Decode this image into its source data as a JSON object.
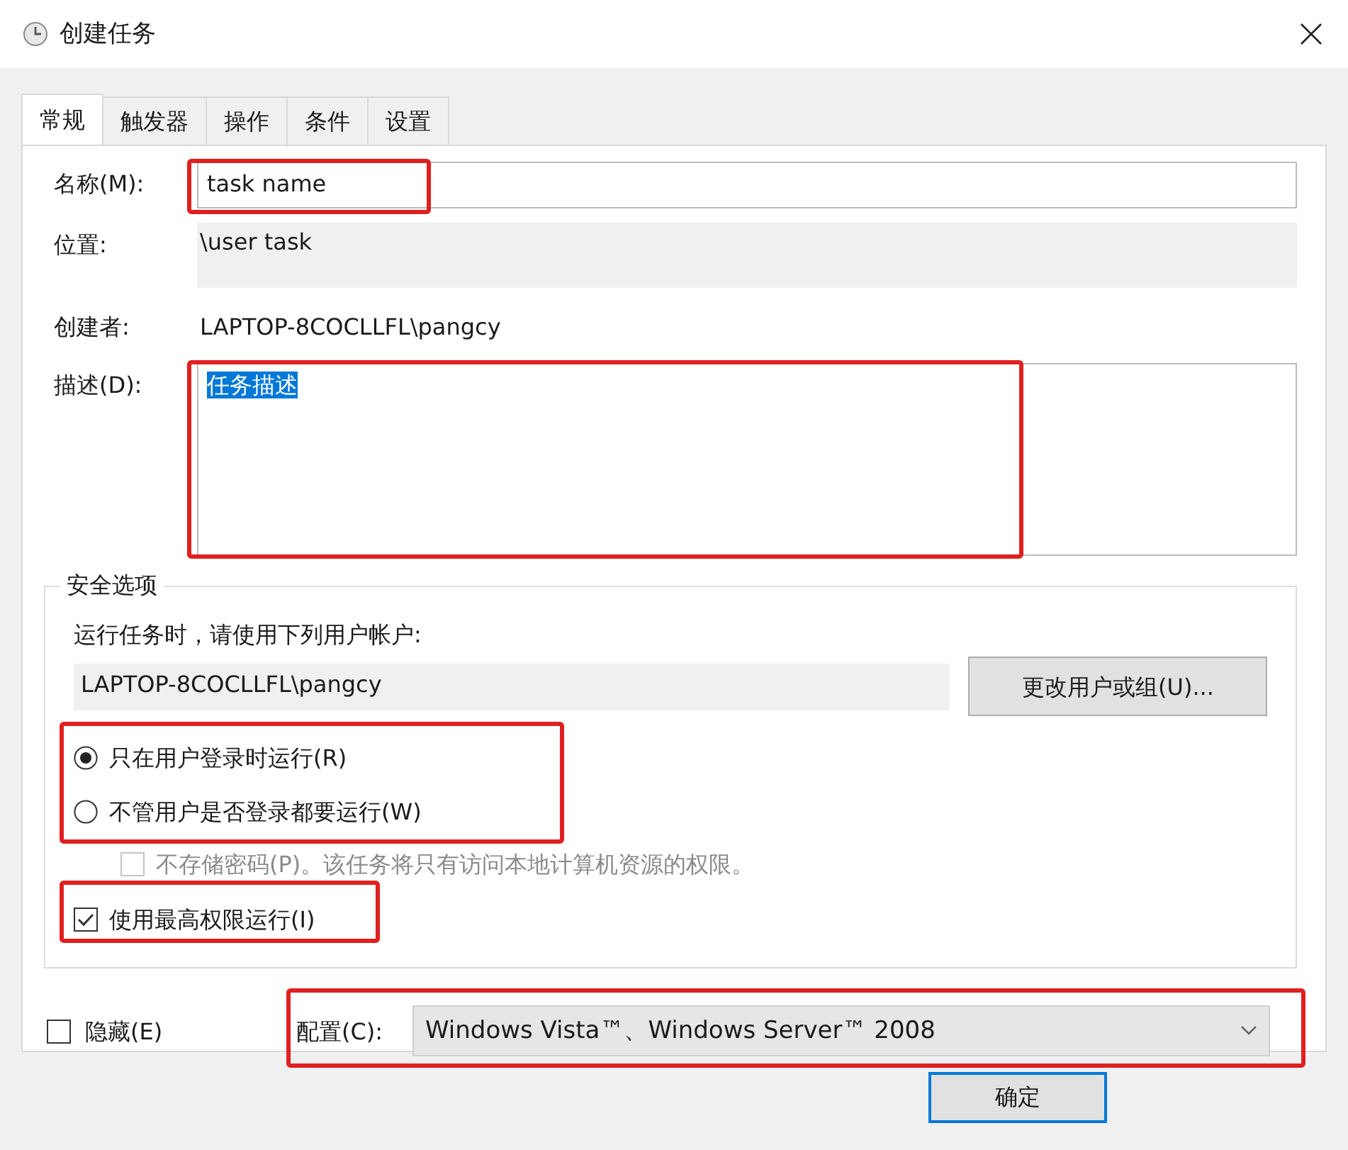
{
  "window": {
    "title": "创建任务"
  },
  "tabs": [
    {
      "label": "常规",
      "selected": true
    },
    {
      "label": "触发器",
      "selected": false
    },
    {
      "label": "操作",
      "selected": false
    },
    {
      "label": "条件",
      "selected": false
    },
    {
      "label": "设置",
      "selected": false
    }
  ],
  "general": {
    "name": {
      "label": "名称(M):",
      "value": "task name",
      "highlighted": true
    },
    "location": {
      "label": "位置:",
      "value": "\\user task"
    },
    "author": {
      "label": "创建者:",
      "value": "LAPTOP-8COCLLFL\\pangcy"
    },
    "description": {
      "label": "描述(D):",
      "value": "任务描述",
      "text_selected": true,
      "highlighted": true
    }
  },
  "security": {
    "title": "安全选项",
    "prompt": "运行任务时，请使用下列用户帐户:",
    "account": "LAPTOP-8COCLLFL\\pangcy",
    "change_button": "更改用户或组(U)...",
    "run_modes": {
      "highlighted": true,
      "items": [
        {
          "label": "只在用户登录时运行(R)",
          "selected": true
        },
        {
          "label": "不管用户是否登录都要运行(W)",
          "selected": false
        }
      ]
    },
    "no_password": {
      "label": "不存储密码(P)。该任务将只有访问本地计算机资源的权限。",
      "checked": false,
      "disabled": true
    },
    "highest_privileges": {
      "label": "使用最高权限运行(I)",
      "checked": true,
      "highlighted": true
    }
  },
  "hidden": {
    "label": "隐藏(E)",
    "checked": false
  },
  "configure": {
    "label": "配置(C):",
    "value": "Windows Vista™、Windows Server™ 2008",
    "highlighted": true
  },
  "buttons": [
    {
      "label": "确定",
      "default": true
    }
  ]
}
